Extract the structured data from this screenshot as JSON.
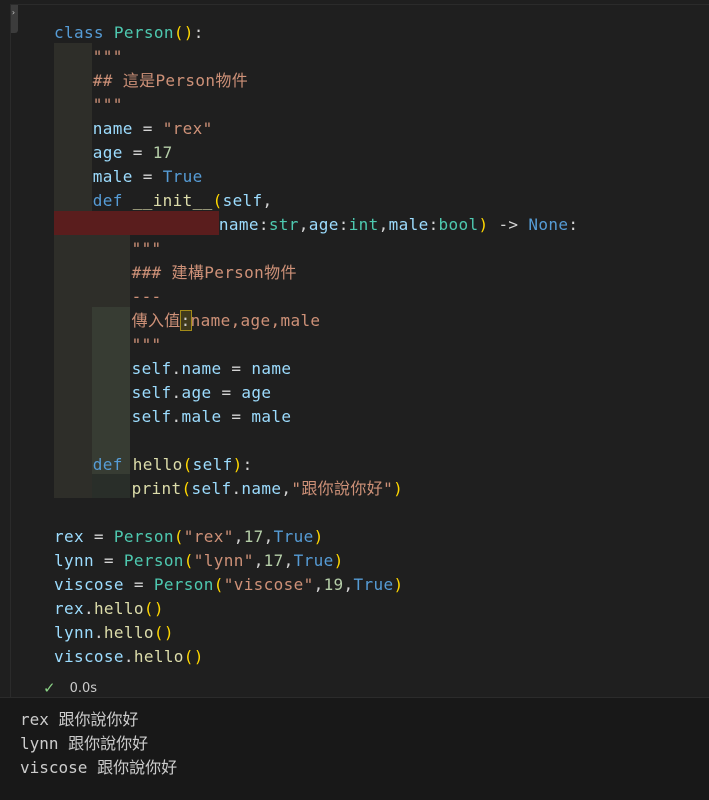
{
  "code_lines": [
    {
      "parts": [
        [
          "kw",
          "class "
        ],
        [
          "cls",
          "Person"
        ],
        [
          "br1",
          "()"
        ],
        [
          "op",
          ":"
        ]
      ]
    },
    {
      "parts": [
        [
          "str",
          "\"\"\""
        ]
      ]
    },
    {
      "parts": [
        [
          "str",
          "## 這是Person物件"
        ]
      ]
    },
    {
      "parts": [
        [
          "str",
          "\"\"\""
        ]
      ]
    },
    {
      "parts": [
        [
          "var",
          "name"
        ],
        [
          "op",
          " = "
        ],
        [
          "str",
          "\"rex\""
        ]
      ]
    },
    {
      "parts": [
        [
          "var",
          "age"
        ],
        [
          "op",
          " = "
        ],
        [
          "num",
          "17"
        ]
      ]
    },
    {
      "parts": [
        [
          "var",
          "male"
        ],
        [
          "op",
          " = "
        ],
        [
          "kw",
          "True"
        ]
      ]
    },
    {
      "parts": [
        [
          "kw",
          "def "
        ],
        [
          "fn",
          "__init__"
        ],
        [
          "br1",
          "("
        ],
        [
          "var",
          "self"
        ],
        [
          "op",
          ","
        ]
      ]
    },
    {
      "parts": [
        [
          "var",
          "name"
        ],
        [
          "op",
          ":"
        ],
        [
          "cls",
          "str"
        ],
        [
          "op",
          ","
        ],
        [
          "var",
          "age"
        ],
        [
          "op",
          ":"
        ],
        [
          "cls",
          "int"
        ],
        [
          "op",
          ","
        ],
        [
          "var",
          "male"
        ],
        [
          "op",
          ":"
        ],
        [
          "cls",
          "bool"
        ],
        [
          "br1",
          ")"
        ],
        [
          "op",
          " -> "
        ],
        [
          "kw",
          "None"
        ],
        [
          "op",
          ":"
        ]
      ]
    },
    {
      "parts": [
        [
          "str",
          "\"\"\""
        ]
      ]
    },
    {
      "parts": [
        [
          "str",
          "### 建構Person物件"
        ]
      ]
    },
    {
      "parts": [
        [
          "str",
          "---"
        ]
      ]
    },
    {
      "parts": [
        [
          "str",
          "傳入值"
        ],
        [
          "hl",
          ":"
        ],
        [
          "str",
          "name,age,male"
        ]
      ]
    },
    {
      "parts": [
        [
          "str",
          "\"\"\""
        ]
      ]
    },
    {
      "parts": [
        [
          "var",
          "self"
        ],
        [
          "op",
          "."
        ],
        [
          "var",
          "name"
        ],
        [
          "op",
          " = "
        ],
        [
          "var",
          "name"
        ]
      ]
    },
    {
      "parts": [
        [
          "var",
          "self"
        ],
        [
          "op",
          "."
        ],
        [
          "var",
          "age"
        ],
        [
          "op",
          " = "
        ],
        [
          "var",
          "age"
        ]
      ]
    },
    {
      "parts": [
        [
          "var",
          "self"
        ],
        [
          "op",
          "."
        ],
        [
          "var",
          "male"
        ],
        [
          "op",
          " = "
        ],
        [
          "var",
          "male"
        ]
      ]
    },
    {
      "parts": []
    },
    {
      "parts": [
        [
          "kw",
          "def "
        ],
        [
          "fn",
          "hello"
        ],
        [
          "br1",
          "("
        ],
        [
          "var",
          "self"
        ],
        [
          "br1",
          ")"
        ],
        [
          "op",
          ":"
        ]
      ]
    },
    {
      "parts": [
        [
          "fn",
          "print"
        ],
        [
          "br1",
          "("
        ],
        [
          "var",
          "self"
        ],
        [
          "op",
          "."
        ],
        [
          "var",
          "name"
        ],
        [
          "op",
          ","
        ],
        [
          "str",
          "\"跟你說你好\""
        ],
        [
          "br1",
          ")"
        ]
      ]
    },
    {
      "parts": []
    },
    {
      "parts": [
        [
          "var",
          "rex"
        ],
        [
          "op",
          " = "
        ],
        [
          "cls",
          "Person"
        ],
        [
          "br1",
          "("
        ],
        [
          "str",
          "\"rex\""
        ],
        [
          "op",
          ","
        ],
        [
          "num",
          "17"
        ],
        [
          "op",
          ","
        ],
        [
          "kw",
          "True"
        ],
        [
          "br1",
          ")"
        ]
      ]
    },
    {
      "parts": [
        [
          "var",
          "lynn"
        ],
        [
          "op",
          " = "
        ],
        [
          "cls",
          "Person"
        ],
        [
          "br1",
          "("
        ],
        [
          "str",
          "\"lynn\""
        ],
        [
          "op",
          ","
        ],
        [
          "num",
          "17"
        ],
        [
          "op",
          ","
        ],
        [
          "kw",
          "True"
        ],
        [
          "br1",
          ")"
        ]
      ]
    },
    {
      "parts": [
        [
          "var",
          "viscose"
        ],
        [
          "op",
          " = "
        ],
        [
          "cls",
          "Person"
        ],
        [
          "br1",
          "("
        ],
        [
          "str",
          "\"viscose\""
        ],
        [
          "op",
          ","
        ],
        [
          "num",
          "19"
        ],
        [
          "op",
          ","
        ],
        [
          "kw",
          "True"
        ],
        [
          "br1",
          ")"
        ]
      ]
    },
    {
      "parts": [
        [
          "var",
          "rex"
        ],
        [
          "op",
          "."
        ],
        [
          "fn",
          "hello"
        ],
        [
          "br1",
          "()"
        ]
      ]
    },
    {
      "parts": [
        [
          "var",
          "lynn"
        ],
        [
          "op",
          "."
        ],
        [
          "fn",
          "hello"
        ],
        [
          "br1",
          "()"
        ]
      ]
    },
    {
      "parts": [
        [
          "var",
          "viscose"
        ],
        [
          "op",
          "."
        ],
        [
          "fn",
          "hello"
        ],
        [
          "br1",
          "()"
        ]
      ]
    }
  ],
  "status": {
    "icon": "check-icon",
    "time": "0.0s"
  },
  "output": [
    "rex 跟你說你好",
    "lynn 跟你說你好",
    "viscose 跟你說你好"
  ],
  "colors": {
    "background": "#1f1f1f",
    "keyword": "#569cd6",
    "class": "#4ec9b0",
    "function": "#dcdcaa",
    "string": "#ce9178",
    "number": "#b5cea8",
    "variable": "#9cdcfe",
    "bracket": "#ffd700",
    "success": "#89d185",
    "error_band": "#5a1d1d"
  }
}
